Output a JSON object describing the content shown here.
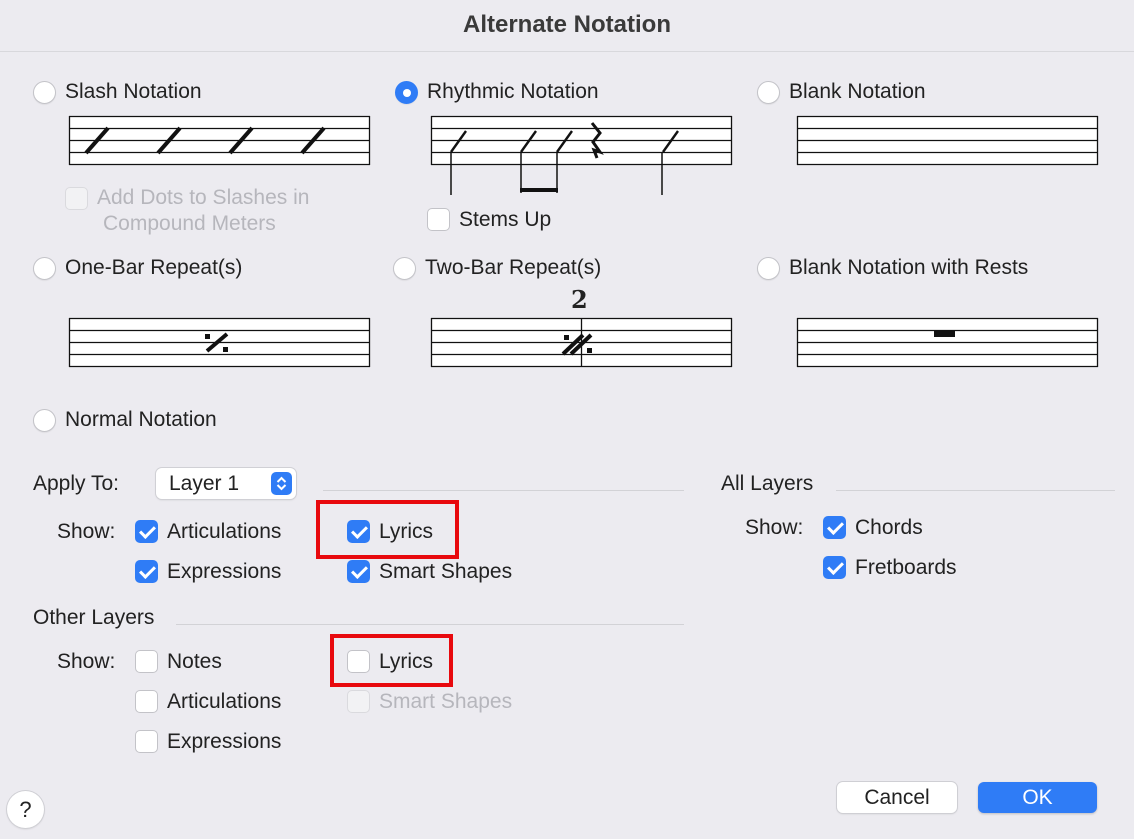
{
  "window": {
    "title": "Alternate Notation"
  },
  "notation_options": {
    "slash": "Slash Notation",
    "rhythmic": "Rhythmic Notation",
    "blank": "Blank Notation",
    "add_dots_line1": "Add Dots to Slashes in",
    "add_dots_line2": "Compound Meters",
    "stems_up": "Stems Up",
    "one_bar": "One-Bar Repeat(s)",
    "two_bar": "Two-Bar Repeat(s)",
    "two_bar_number": "2",
    "blank_rests": "Blank Notation with Rests",
    "normal": "Normal Notation",
    "selected": "Rhythmic Notation"
  },
  "apply_to": {
    "label": "Apply To:",
    "selected_layer": "Layer 1",
    "show_label": "Show:",
    "articulations": {
      "label": "Articulations",
      "checked": true
    },
    "lyrics": {
      "label": "Lyrics",
      "checked": true
    },
    "expressions": {
      "label": "Expressions",
      "checked": true
    },
    "smart_shapes": {
      "label": "Smart Shapes",
      "checked": true
    }
  },
  "other_layers": {
    "label": "Other Layers",
    "show_label": "Show:",
    "notes": {
      "label": "Notes",
      "checked": false
    },
    "lyrics": {
      "label": "Lyrics",
      "checked": false
    },
    "articulations": {
      "label": "Articulations",
      "checked": false
    },
    "smart_shapes": {
      "label": "Smart Shapes",
      "checked": false,
      "disabled": true
    },
    "expressions": {
      "label": "Expressions",
      "checked": false
    }
  },
  "all_layers": {
    "label": "All Layers",
    "show_label": "Show:",
    "chords": {
      "label": "Chords",
      "checked": true
    },
    "fretboards": {
      "label": "Fretboards",
      "checked": true
    }
  },
  "buttons": {
    "cancel": "Cancel",
    "ok": "OK",
    "help": "?"
  },
  "colors": {
    "accent": "#2f7cf6",
    "highlight": "#e8090e",
    "background": "#ecebf0"
  }
}
